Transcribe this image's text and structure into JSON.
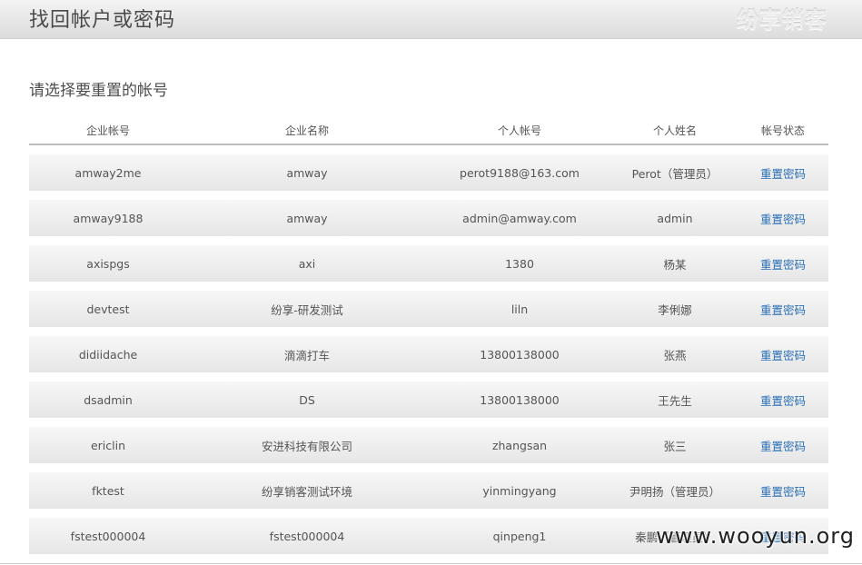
{
  "header": {
    "title": "找回帐户或密码",
    "brand": "纷享销客"
  },
  "subtitle": "请选择要重置的帐号",
  "table": {
    "columns": [
      "企业帐号",
      "企业名称",
      "个人帐号",
      "个人姓名",
      "帐号状态"
    ],
    "rows": [
      {
        "enterprise_account": "amway2me",
        "enterprise_name": "amway",
        "personal_account": "perot9188@163.com",
        "personal_name": "Perot（管理员）",
        "action": "重置密码"
      },
      {
        "enterprise_account": "amway9188",
        "enterprise_name": "amway",
        "personal_account": "admin@amway.com",
        "personal_name": "admin",
        "action": "重置密码"
      },
      {
        "enterprise_account": "axispgs",
        "enterprise_name": "axi",
        "personal_account": "1380",
        "personal_name": "杨某",
        "action": "重置密码"
      },
      {
        "enterprise_account": "devtest",
        "enterprise_name": "纷享-研发测试",
        "personal_account": "liln",
        "personal_name": "李俐娜",
        "action": "重置密码"
      },
      {
        "enterprise_account": "didiidache",
        "enterprise_name": "滴滴打车",
        "personal_account": "13800138000",
        "personal_name": "张燕",
        "action": "重置密码"
      },
      {
        "enterprise_account": "dsadmin",
        "enterprise_name": "DS",
        "personal_account": "13800138000",
        "personal_name": "王先生",
        "action": "重置密码"
      },
      {
        "enterprise_account": "ericlin",
        "enterprise_name": "安进科技有限公司",
        "personal_account": "zhangsan",
        "personal_name": "张三",
        "action": "重置密码"
      },
      {
        "enterprise_account": "fktest",
        "enterprise_name": "纷享销客测试环境",
        "personal_account": "yinmingyang",
        "personal_name": "尹明扬（管理员）",
        "action": "重置密码"
      },
      {
        "enterprise_account": "fstest000004",
        "enterprise_name": "fstest000004",
        "personal_account": "qinpeng1",
        "personal_name": "秦鹏（管理员）",
        "action": "重置密码"
      }
    ]
  },
  "watermark": "www.wooyun.org"
}
